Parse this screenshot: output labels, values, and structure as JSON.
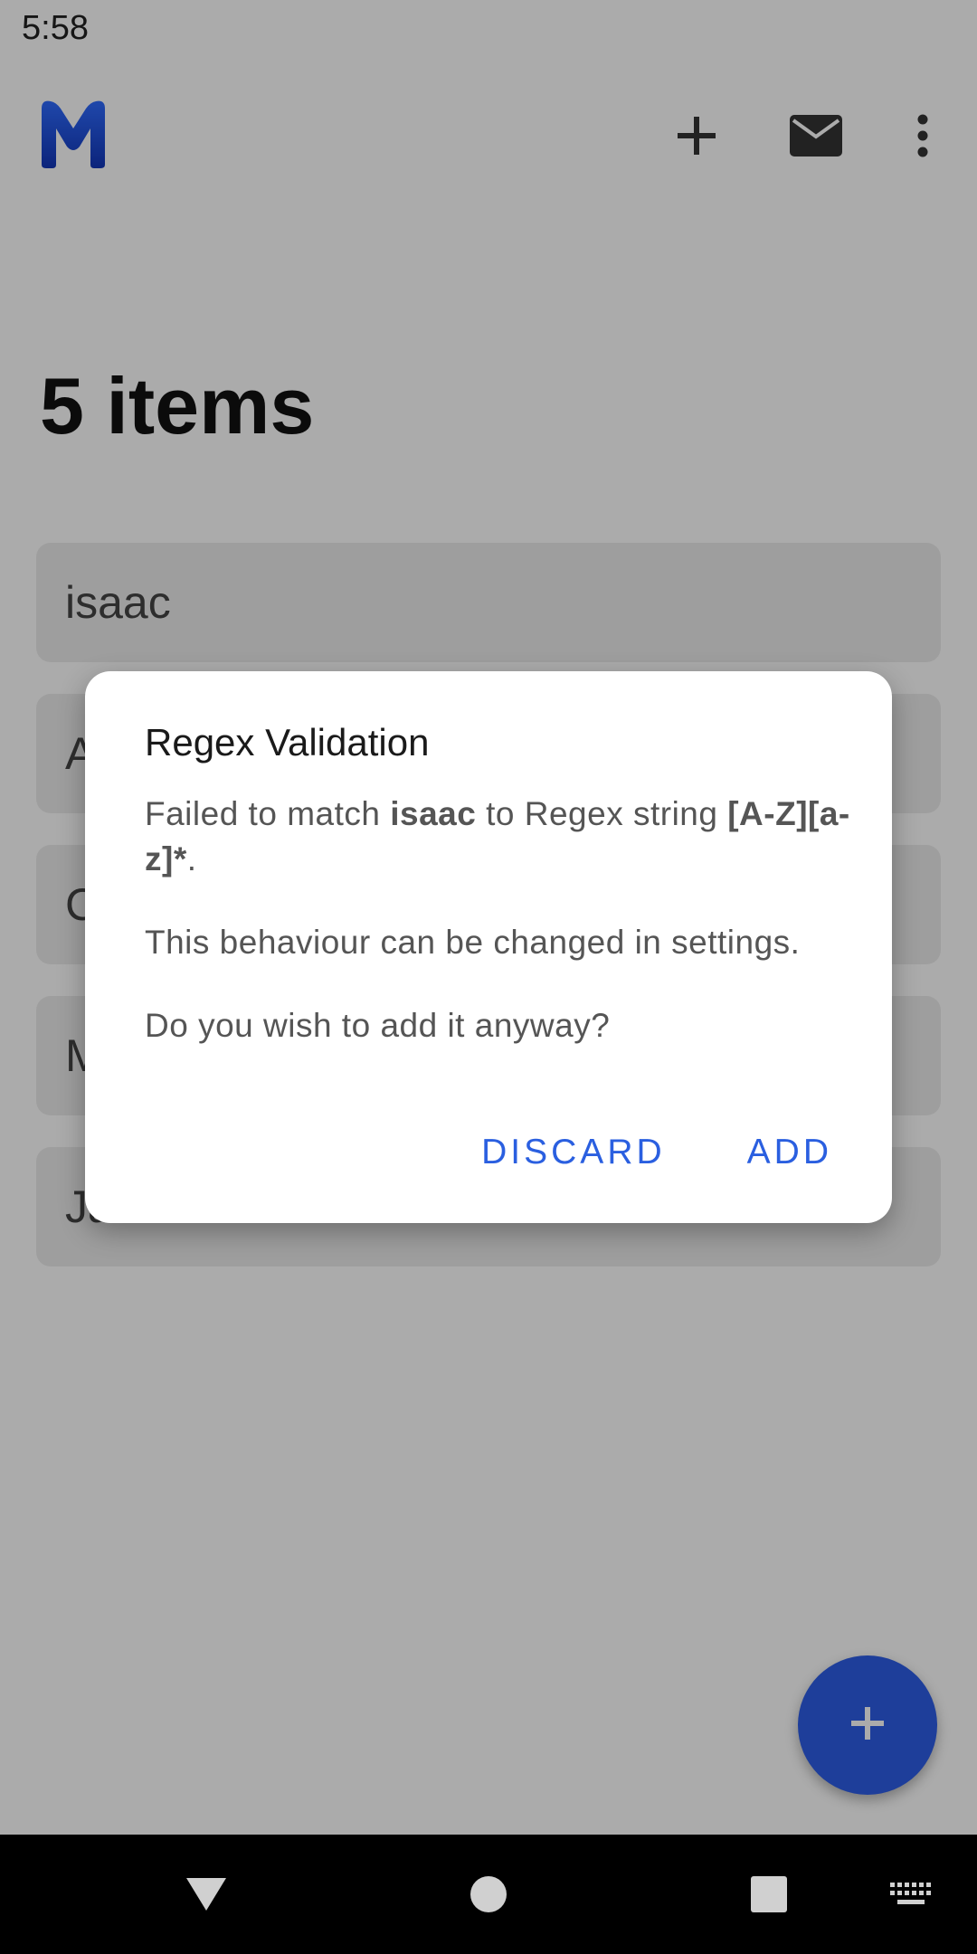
{
  "status_bar": {
    "time": "5:58",
    "icons": [
      "wifi-icon",
      "signal-icon",
      "battery-icon"
    ]
  },
  "app_bar": {
    "logo": "app-logo-m",
    "actions": [
      "add-icon",
      "mail-icon",
      "more-vert-icon"
    ]
  },
  "page": {
    "heading": "5 items"
  },
  "list": {
    "items": [
      {
        "label": "isaac"
      },
      {
        "label": "A"
      },
      {
        "label": "C"
      },
      {
        "label": "M"
      },
      {
        "label": "Jamie"
      }
    ]
  },
  "dialog": {
    "title": "Regex Validation",
    "line1_prefix": "Failed to match ",
    "line1_value": "isaac",
    "line1_mid": " to Regex string ",
    "line1_regex": "[A-Z][a-z]*",
    "line1_end": ".",
    "line2": "This behaviour can be changed in settings.",
    "line3": "Do you wish to add it anyway?",
    "discard_label": "DISCARD",
    "add_label": "ADD"
  },
  "nav_bar": {
    "buttons": [
      "back-icon",
      "home-icon",
      "recents-icon",
      "keyboard-icon"
    ]
  },
  "colors": {
    "accent": "#2d5de6",
    "dialog_button": "#2a5fe0",
    "scrim": "rgba(0,0,0,0.33)"
  }
}
